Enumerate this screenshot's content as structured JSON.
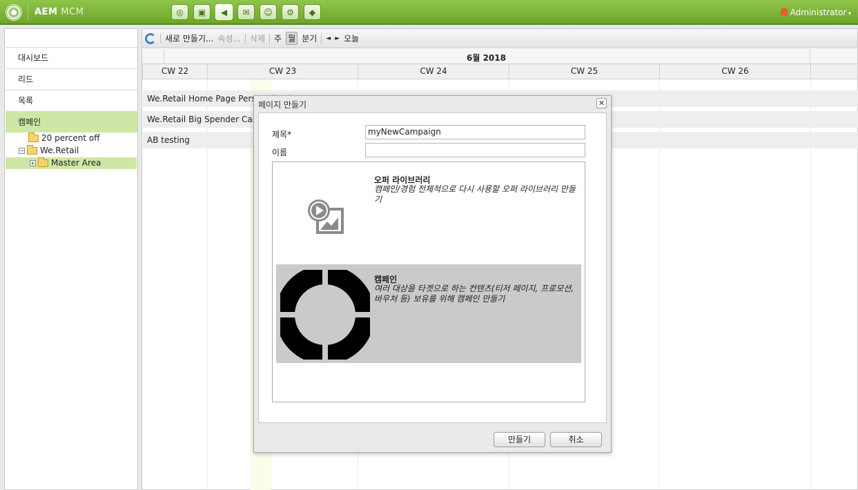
{
  "app": {
    "title_bold": "AEM",
    "title_light": "MCM",
    "user": "Administrator"
  },
  "topbar_icons": [
    "globe-icon",
    "camera-icon",
    "megaphone-icon",
    "mail-icon",
    "users-icon",
    "tools-icon",
    "tag-icon"
  ],
  "sidebar": {
    "items": [
      {
        "label": "대시보드"
      },
      {
        "label": "리드"
      },
      {
        "label": "목록"
      },
      {
        "label": "캠페인"
      }
    ],
    "tree": [
      {
        "label": "20 percent off"
      },
      {
        "label": "We.Retail",
        "expander": "−"
      },
      {
        "label": "Master Area",
        "expander": "+"
      }
    ]
  },
  "toolbar": {
    "new": "새로 만들기...",
    "properties": "속성...",
    "delete": "삭제",
    "week": "주",
    "month": "월",
    "quarter": "분기",
    "prev": "◄",
    "next": "►",
    "today": "오늘"
  },
  "calendar": {
    "month": "6월 2018",
    "weeks": [
      "CW 22",
      "CW 23",
      "CW 24",
      "CW 25",
      "CW 26"
    ],
    "rows": [
      "We.Retail Home Page Personalization",
      "We.Retail Big Spender Campaign",
      "AB testing"
    ]
  },
  "dialog": {
    "title": "페이지 만들기",
    "close": "✕",
    "title_label": "제목*",
    "title_value": "myNewCampaign",
    "name_label": "이름",
    "name_value": "",
    "templates": [
      {
        "title": "오퍼 라이브러리",
        "desc": "캠페인/경험 전체적으로 다시 사용할 오퍼 라이브러리 만들기"
      },
      {
        "title": "캠페인",
        "desc": "여러 대상을 타겟으로 하는 컨텐츠(티저 페이지, 프로모션, 바우처 등) 보유를 위해 캠페인 만들기"
      }
    ],
    "create_button": "만들기",
    "cancel_button": "취소"
  }
}
